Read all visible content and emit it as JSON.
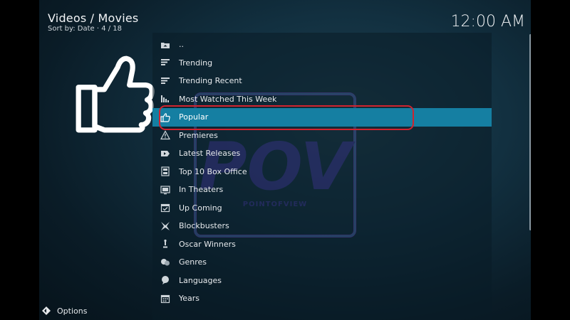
{
  "header": {
    "title": "Videos / Movies",
    "subtitle": "Sort by: Date  ·  4 / 18"
  },
  "clock": "12:00 AM",
  "feature_icon": "thumbs-up-icon",
  "watermark": {
    "logo_text": "POV",
    "tagline": "POINTOFVIEW",
    "color": "#5b3aa6"
  },
  "list": {
    "items": [
      {
        "label": "..",
        "icon": "folder-up-icon"
      },
      {
        "label": "Trending",
        "icon": "bars-icon"
      },
      {
        "label": "Trending Recent",
        "icon": "bars-icon"
      },
      {
        "label": "Most Watched This Week",
        "icon": "bar-chart-icon"
      },
      {
        "label": "Popular",
        "icon": "thumbs-up-icon"
      },
      {
        "label": "Premieres",
        "icon": "warning-icon"
      },
      {
        "label": "Latest Releases",
        "icon": "play-tag-icon"
      },
      {
        "label": "Top 10 Box Office",
        "icon": "film-icon"
      },
      {
        "label": "In Theaters",
        "icon": "screen-icon"
      },
      {
        "label": "Up Coming",
        "icon": "calendar-check-icon"
      },
      {
        "label": "Blockbusters",
        "icon": "star-burst-icon"
      },
      {
        "label": "Oscar Winners",
        "icon": "trophy-icon"
      },
      {
        "label": "Genres",
        "icon": "masks-icon"
      },
      {
        "label": "Languages",
        "icon": "speech-icon"
      },
      {
        "label": "Years",
        "icon": "calendar-icon"
      }
    ],
    "selected_index": 4
  },
  "footer": {
    "options_label": "Options",
    "options_icon": "diamond-arrows-icon"
  },
  "colors": {
    "selection": "#157fa2",
    "highlight_ring": "#d0242f"
  }
}
